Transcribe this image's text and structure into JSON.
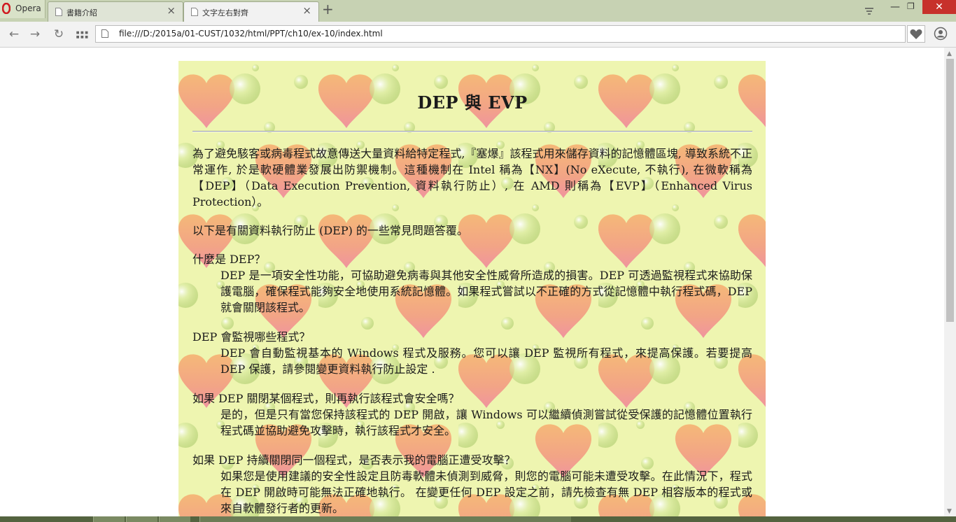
{
  "browser": {
    "name": "Opera",
    "tabs": [
      {
        "label": "書籍介紹",
        "active": false
      },
      {
        "label": "文字左右對齊",
        "active": true
      }
    ],
    "url": "file:///D:/2015a/01-CUST/1032/html/PPT/ch10/ex-10/index.html",
    "icons": [
      "back-icon",
      "forward-icon",
      "reload-icon",
      "speed-dial-icon",
      "page-icon",
      "heart-icon",
      "profile-icon",
      "tab-close-icon",
      "new-tab-icon"
    ]
  },
  "page": {
    "title": "DEP 與 EVP",
    "intro": "為了避免駭客或病毒程式故意傳送大量資料給特定程式,『塞爆』該程式用來儲存資料的記憶體區塊, 導致系統不正常運作, 於是軟硬體業發展出防禦機制。這種機制在 Intel 稱為【NX】(No eXecute, 不執行), 在微軟稱為【DEP】（Data Execution Prevention, 資料執行防止）, 在 AMD 則稱為【EVP】（Enhanced Virus Protection）。",
    "intro2": "以下是有關資料執行防止 (DEP) 的一些常見問題答覆。",
    "faqs": [
      {
        "q": "什麼是 DEP？",
        "a": "DEP 是一項安全性功能，可協助避免病毒與其他安全性威脅所造成的損害。DEP 可透過監視程式來協助保護電腦，確保程式能夠安全地使用系統記憶體。如果程式嘗試以不正確的方式從記憶體中執行程式碼，DEP 就會關閉該程式。"
      },
      {
        "q": "DEP 會監視哪些程式？",
        "a": "DEP 會自動監視基本的 Windows 程式及服務。您可以讓 DEP 監視所有程式，來提高保護。若要提高 DEP 保護，請參閱變更資料執行防止設定 ."
      },
      {
        "q": "如果 DEP 關閉某個程式，則再執行該程式會安全嗎？",
        "a": "是的，但是只有當您保持該程式的 DEP 開啟，讓 Windows 可以繼續偵測嘗試從受保護的記憶體位置執行程式碼並協助避免攻擊時，執行該程式才安全。"
      },
      {
        "q": "如果 DEP 持續關閉同一個程式，是否表示我的電腦正遭受攻擊？",
        "a": "如果您是使用建議的安全性設定且防毒軟體未偵測到威脅，則您的電腦可能未遭受攻擊。在此情況下，程式在 DEP 開啟時可能無法正確地執行。 在變更任何 DEP 設定之前，請先檢查有無 DEP 相容版本的程式或來自軟體發行者的更新。"
      }
    ]
  },
  "colors": {
    "tabstrip": "#c7d2b3",
    "doc_bg": "#eef5b0",
    "heart_a": "#f6a96a",
    "heart_b": "#f07c9a",
    "close_red": "#c7312b"
  }
}
